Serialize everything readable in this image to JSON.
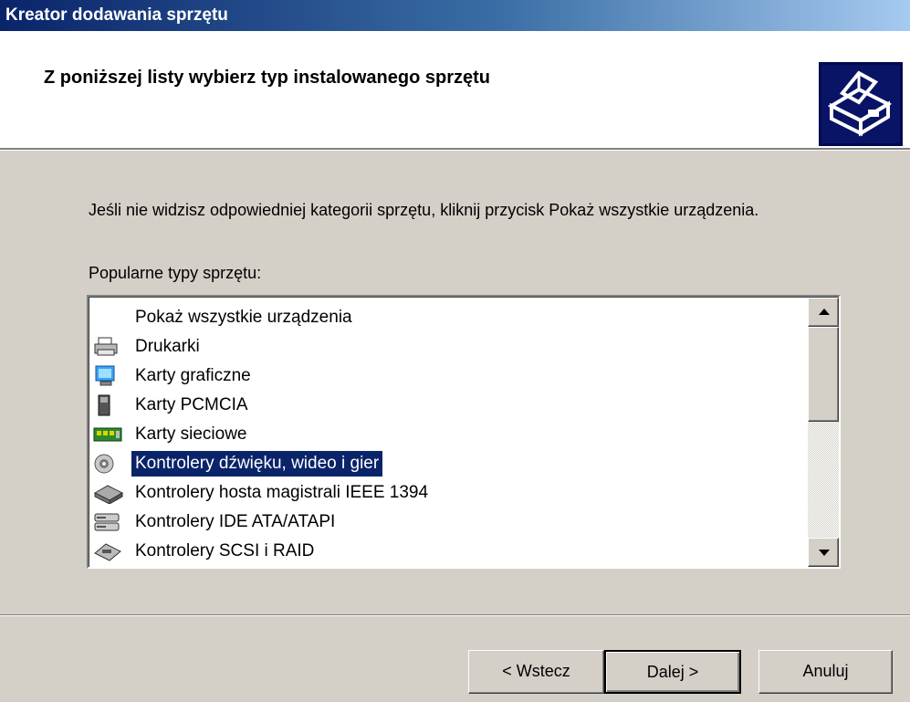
{
  "window": {
    "title": "Kreator dodawania sprzętu"
  },
  "header": {
    "title": "Z poniższej listy wybierz typ instalowanego sprzętu",
    "icon": "hardware-wizard-icon"
  },
  "main": {
    "info_text": "Jeśli nie widzisz odpowiedniej kategorii sprzętu, kliknij przycisk Pokaż wszystkie urządzenia.",
    "list_label": "Popularne typy sprzętu:",
    "list_items": [
      {
        "label": "Pokaż wszystkie urządzenia",
        "icon": "none",
        "selected": false
      },
      {
        "label": "Drukarki",
        "icon": "printer-icon",
        "selected": false
      },
      {
        "label": "Karty graficzne",
        "icon": "display-adapter-icon",
        "selected": false
      },
      {
        "label": "Karty PCMCIA",
        "icon": "pcmcia-card-icon",
        "selected": false
      },
      {
        "label": "Karty sieciowe",
        "icon": "network-card-icon",
        "selected": false
      },
      {
        "label": "Kontrolery dźwięku, wideo i gier",
        "icon": "sound-controller-icon",
        "selected": true
      },
      {
        "label": "Kontrolery hosta magistrali IEEE 1394",
        "icon": "ieee1394-controller-icon",
        "selected": false
      },
      {
        "label": "Kontrolery IDE ATA/ATAPI",
        "icon": "ide-controller-icon",
        "selected": false
      },
      {
        "label": "Kontrolery SCSI i RAID",
        "icon": "scsi-controller-icon",
        "selected": false
      }
    ]
  },
  "buttons": {
    "back": "< Wstecz",
    "next": "Dalej >",
    "cancel": "Anuluj"
  },
  "colors": {
    "title_gradient_start": "#0a246a",
    "title_gradient_end": "#a6caf0",
    "dialog_face": "#d4d0c8",
    "selection": "#0a246a"
  }
}
